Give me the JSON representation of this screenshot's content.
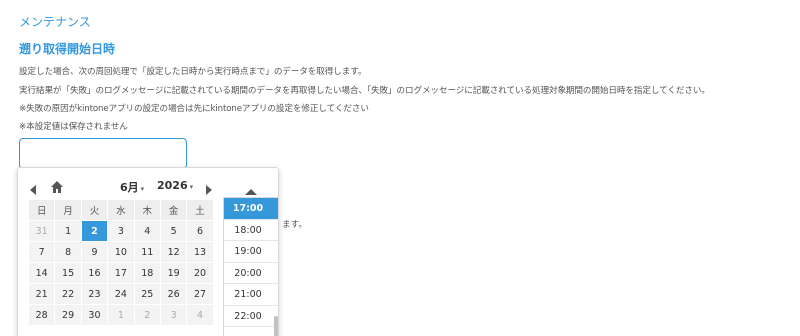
{
  "section": {
    "title": "メンテナンス"
  },
  "field": {
    "title": "遡り取得開始日時",
    "descriptions": [
      "設定した場合、次の周回処理で「設定した日時から実行時点まで」のデータを取得します。",
      "実行結果が「失敗」のログメッセージに記載されている期間のデータを再取得したい場合、「失敗」のログメッセージに記載されている処理対象期間の開始日時を指定してください。",
      "※失敗の原因がkintoneアプリの設定の場合は先にkintoneアプリの設定を修正してください",
      "※本設定値は保存されません"
    ],
    "input_value": "",
    "hidden_text_tail": "ます。"
  },
  "picker": {
    "month_label": "6月",
    "year_label": "2026",
    "weekdays": [
      "日",
      "月",
      "火",
      "水",
      "木",
      "金",
      "土"
    ],
    "weeks": [
      [
        "31",
        "1",
        "2",
        "3",
        "4",
        "5",
        "6"
      ],
      [
        "7",
        "8",
        "9",
        "10",
        "11",
        "12",
        "13"
      ],
      [
        "14",
        "15",
        "16",
        "17",
        "18",
        "19",
        "20"
      ],
      [
        "21",
        "22",
        "23",
        "24",
        "25",
        "26",
        "27"
      ],
      [
        "28",
        "29",
        "30",
        "1",
        "2",
        "3",
        "4"
      ]
    ],
    "selected_day": "2",
    "times": [
      "17:00",
      "18:00",
      "19:00",
      "20:00",
      "21:00",
      "22:00"
    ],
    "selected_time": "17:00",
    "colors": {
      "accent": "#3498db",
      "cell_bg": "#f3f3f3",
      "header_bg": "#eeeeee"
    }
  }
}
